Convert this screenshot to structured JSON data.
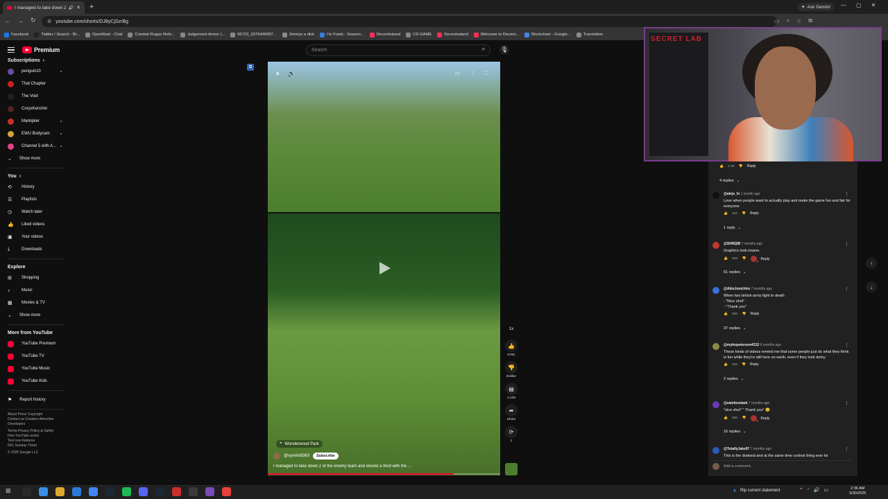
{
  "browser": {
    "tab_title": "I managed to take down 2 ...",
    "url": "youtube.com/shorts/DJ8yCjSzrBg",
    "ask_gemini": "Ask Gemini",
    "bookmarks": [
      {
        "label": "Facebook",
        "color": "#1877f2"
      },
      {
        "label": "Twitter / Search - Bi...",
        "color": "#222222"
      },
      {
        "label": "OpenRaid - Chat",
        "color": "#888888"
      },
      {
        "label": "Combat Rogue Refo...",
        "color": "#888888"
      },
      {
        "label": "Judgement Armor (...",
        "color": "#888888"
      },
      {
        "label": "66722_3376446997...",
        "color": "#888888"
      },
      {
        "label": "Jimmys a dick",
        "color": "#888888"
      },
      {
        "label": "I'm Frank - Season...",
        "color": "#3a7bd5"
      },
      {
        "label": "Decentraland",
        "color": "#ff2d55"
      },
      {
        "label": "CD GAME",
        "color": "#888888"
      },
      {
        "label": "Decentraland",
        "color": "#ff2d55"
      },
      {
        "label": "Welcome to Decent...",
        "color": "#ff2d55"
      },
      {
        "label": "Blockchain - Google...",
        "color": "#4285f4"
      },
      {
        "label": "Translation",
        "color": "#888888"
      }
    ]
  },
  "youtube": {
    "brand": "Premium",
    "search_placeholder": "Search",
    "subscriptions_header": "Subscriptions",
    "subscriptions": [
      {
        "label": "penguinz0",
        "color": "#6a4ea0",
        "dot": true
      },
      {
        "label": "That Chapter",
        "color": "#cc2222",
        "dot": false
      },
      {
        "label": "The Void",
        "color": "#222222",
        "dot": false
      },
      {
        "label": "CoryxKenshin",
        "color": "#552222",
        "dot": false
      },
      {
        "label": "Markiplier",
        "color": "#c8302a",
        "dot": true
      },
      {
        "label": "EWU Bodycam",
        "color": "#d2a43a",
        "dot": true
      },
      {
        "label": "Channel 5 with A...",
        "color": "#e53e8a",
        "dot": true
      }
    ],
    "show_more_1": "Show more",
    "you_header": "You",
    "you_items": [
      {
        "label": "History",
        "icon": "history-icon",
        "glyph": "⟲"
      },
      {
        "label": "Playlists",
        "icon": "playlists-icon",
        "glyph": "☰"
      },
      {
        "label": "Watch later",
        "icon": "clock-icon",
        "glyph": "◷"
      },
      {
        "label": "Liked videos",
        "icon": "thumbs-up-icon",
        "glyph": "👍"
      },
      {
        "label": "Your videos",
        "icon": "your-videos-icon",
        "glyph": "▣"
      },
      {
        "label": "Downloads",
        "icon": "download-icon",
        "glyph": "⤓"
      }
    ],
    "explore_header": "Explore",
    "explore_items": [
      {
        "label": "Shopping",
        "icon": "shopping-bag-icon",
        "glyph": "⊞"
      },
      {
        "label": "Music",
        "icon": "music-note-icon",
        "glyph": "♪"
      },
      {
        "label": "Movies & TV",
        "icon": "clapperboard-icon",
        "glyph": "▦"
      }
    ],
    "show_more_2": "Show more",
    "more_header": "More from YouTube",
    "more_items": [
      {
        "label": "YouTube Premium",
        "color": "#ff0033"
      },
      {
        "label": "YouTube TV",
        "color": "#ff0033"
      },
      {
        "label": "YouTube Music",
        "color": "#ff0033"
      },
      {
        "label": "YouTube Kids",
        "color": "#ff0033"
      }
    ],
    "report_history": "Report history",
    "footer_lines": [
      "About  Press  Copyright",
      "Contact us  Creators  Advertise",
      "Developers",
      "",
      "Terms  Privacy  Policy & Safety",
      "How YouTube works",
      "Test new features",
      "NFL Sunday Ticket",
      "",
      "© 2025 Google LLC"
    ]
  },
  "short": {
    "location": "Wonderwood Park",
    "channel": "@vyrelm9363",
    "subscribe": "Subscribe",
    "title": "I managed to take down 2 of the enemy team and wound a third with the ...",
    "progress": 0.8,
    "actions": [
      {
        "name": "speed-button",
        "icon": "speed-icon",
        "glyph": "1x",
        "label": ""
      },
      {
        "name": "like-button",
        "icon": "thumbs-up-icon",
        "glyph": "👍",
        "label": "876K"
      },
      {
        "name": "dislike-button",
        "icon": "thumbs-down-icon",
        "glyph": "👎",
        "label": "Dislike"
      },
      {
        "name": "comments-button",
        "icon": "comment-icon",
        "glyph": "▤",
        "label": "3,439"
      },
      {
        "name": "share-button",
        "icon": "share-icon",
        "glyph": "➦",
        "label": "Share"
      },
      {
        "name": "remix-button",
        "icon": "remix-icon",
        "glyph": "⟳",
        "label": "1"
      }
    ]
  },
  "comments": {
    "top_likes": "2.4K",
    "top_reply": "Reply",
    "top_replies": "4 replies",
    "items": [
      {
        "user": "@alejs_fx",
        "time": "1 month ago",
        "text": "Love when people want to actually play and make the game fun and fair for everyone",
        "likes": "182",
        "replies": "1 reply",
        "heart": false,
        "color": "#111111"
      },
      {
        "user": "@SHNQBI",
        "time": "7 months ago",
        "text": "Graphics look insane.",
        "likes": "92K",
        "replies": "61 replies",
        "heart": true,
        "color": "#c0392b"
      },
      {
        "user": "@AkioJunichiro",
        "time": "7 months ago",
        "text": "When two british army fight to death\n- \"Nice shot\"\n- \"Thank you\"",
        "likes": "28K",
        "replies": "37 replies",
        "heart": false,
        "color": "#3a6fd8"
      },
      {
        "user": "@mylespeterson4212",
        "time": "6 months ago",
        "text": "These kinds of videos remind me that some people just do what they think is fun while they're still here on earth, even if they look dorky",
        "likes": "202",
        "replies": "2 replies",
        "heart": false,
        "color": "#8a8a4a"
      },
      {
        "user": "@valeforedark",
        "time": "7 months ago",
        "text": "\"nice shot\" \" Thank you\" 😊",
        "likes": "29K",
        "replies": "16 replies",
        "heart": true,
        "color": "#6a3ab8"
      },
      {
        "user": "@TotallyJake97",
        "time": "7 months ago",
        "text": "This is the dorkiest and at the same time coolest thing ever lol",
        "likes": "",
        "replies": "",
        "heart": false,
        "color": "#2a5ab8"
      }
    ],
    "reply_label": "Reply",
    "add_comment": "Add a comment..."
  },
  "taskbar": {
    "news": "Rip current statement",
    "time": "2:36 AM",
    "date": "3/30/2025",
    "app_colors": [
      "#3a3a3a",
      "#2a2a2a",
      "#3a8ee6",
      "#e0a92e",
      "#2d7ad6",
      "#4285f4",
      "#1b2838",
      "#1db954",
      "#5865f2",
      "#1b2838",
      "#c9302c",
      "#3a3a3a",
      "#7a4ab8",
      "#e8413c"
    ]
  },
  "webcam": {
    "brand_text": "SECRET LAB"
  }
}
